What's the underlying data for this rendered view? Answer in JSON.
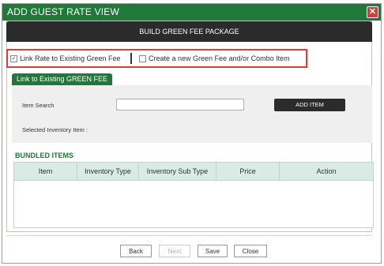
{
  "window": {
    "title": "ADD GUEST RATE VIEW",
    "close_glyph": "✕"
  },
  "package_bar": {
    "label": "BUILD GREEN FEE PACKAGE"
  },
  "options": [
    {
      "label": "Link Rate to Existing Green Fee",
      "checked": true,
      "mark": "✓"
    },
    {
      "label": "Create a new Green Fee and/or Combo Item",
      "checked": false,
      "mark": ""
    }
  ],
  "tab": {
    "label": "Link to Existing GREEN FEE"
  },
  "search": {
    "item_search_label": "Item Search",
    "input_value": "",
    "selected_label": "Selected Inventory Item :",
    "add_button": "ADD ITEM"
  },
  "bundled": {
    "title": "BUNDLED ITEMS",
    "columns": [
      "Item",
      "Inventory Type",
      "Inventory Sub Type",
      "Price",
      "Action"
    ]
  },
  "footer": {
    "back": "Back",
    "next": "Next",
    "save": "Save",
    "close": "Close"
  },
  "colors": {
    "accent": "#1f7a3a",
    "dark_bar": "#2b2b2b",
    "highlight": "#e03b3b",
    "header_row": "#d9ebe4"
  }
}
